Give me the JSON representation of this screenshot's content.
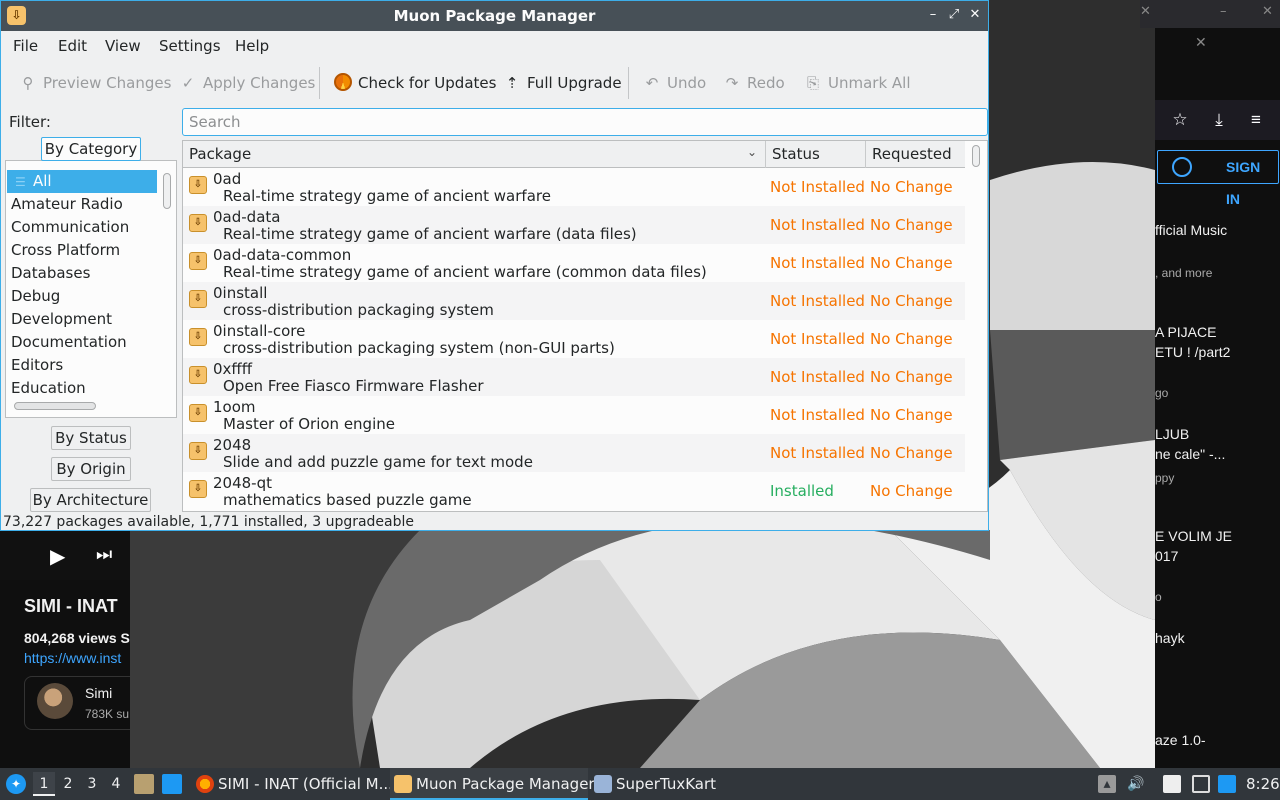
{
  "window": {
    "title": "Muon Package Manager",
    "controls": {
      "minimize": "–",
      "maximize": "⤢",
      "close": "✕"
    }
  },
  "menu": [
    "File",
    "Edit",
    "View",
    "Settings",
    "Help"
  ],
  "toolbar": {
    "preview": "Preview Changes",
    "apply": "Apply Changes",
    "check_updates": "Check for Updates",
    "full_upgrade": "Full Upgrade",
    "undo": "Undo",
    "redo": "Redo",
    "unmark_all": "Unmark All"
  },
  "filter": {
    "label": "Filter:",
    "tabs": {
      "category": "By Category",
      "status": "By Status",
      "origin": "By Origin",
      "architecture": "By Architecture"
    },
    "categories": [
      "All",
      "Amateur Radio",
      "Communication",
      "Cross Platform",
      "Databases",
      "Debug",
      "Development",
      "Documentation",
      "Editors",
      "Education"
    ]
  },
  "search": {
    "placeholder": "Search",
    "value": ""
  },
  "table": {
    "headers": {
      "package": "Package",
      "status": "Status",
      "requested": "Requested"
    },
    "rows": [
      {
        "name": "0ad",
        "desc": "Real-time strategy game of ancient warfare",
        "status": "Not Installed",
        "requested": "No Change"
      },
      {
        "name": "0ad-data",
        "desc": "Real-time strategy game of ancient warfare (data files)",
        "status": "Not Installed",
        "requested": "No Change"
      },
      {
        "name": "0ad-data-common",
        "desc": "Real-time strategy game of ancient warfare (common data files)",
        "status": "Not Installed",
        "requested": "No Change"
      },
      {
        "name": "0install",
        "desc": "cross-distribution packaging system",
        "status": "Not Installed",
        "requested": "No Change"
      },
      {
        "name": "0install-core",
        "desc": "cross-distribution packaging system (non-GUI parts)",
        "status": "Not Installed",
        "requested": "No Change"
      },
      {
        "name": "0xffff",
        "desc": "Open Free Fiasco Firmware Flasher",
        "status": "Not Installed",
        "requested": "No Change"
      },
      {
        "name": "1oom",
        "desc": "Master of Orion engine",
        "status": "Not Installed",
        "requested": "No Change"
      },
      {
        "name": "2048",
        "desc": "Slide and add puzzle game for text mode",
        "status": "Not Installed",
        "requested": "No Change"
      },
      {
        "name": "2048-qt",
        "desc": "mathematics based puzzle game",
        "status": "Installed",
        "requested": "No Change"
      }
    ]
  },
  "statusbar": "73,227 packages available, 1,771 installed, 3 upgradeable",
  "colors": {
    "not_installed": "#f67400",
    "installed": "#27ae60",
    "requested": "#f67400",
    "accent": "#3daee9"
  },
  "browser": {
    "video_title": "SIMI - INAT",
    "views": "804,268 views  S",
    "link": "https://www.inst",
    "channel_name": "Simi",
    "channel_subs": "783K su",
    "sign_in": "SIGN IN",
    "recs": [
      {
        "t1": "fficial Music",
        "s": ", and more"
      },
      {
        "t1": "A PIJACE",
        "t2": "ETU ! /part2",
        "s": "go"
      },
      {
        "t1": "LJUB",
        "t2": "ne cale\" -...",
        "s": "ppy"
      },
      {
        "t1": "E VOLIM JE",
        "t2": "017",
        "s": "o"
      },
      {
        "t1": "hayk"
      },
      {
        "t1": "aze 1.0-"
      }
    ]
  },
  "taskbar": {
    "desktops": [
      "1",
      "2",
      "3",
      "4"
    ],
    "tasks": [
      {
        "label": "SIMI - INAT (Official M..."
      },
      {
        "label": "Muon Package Manager"
      },
      {
        "label": "SuperTuxKart"
      }
    ],
    "clock": "8:26"
  }
}
